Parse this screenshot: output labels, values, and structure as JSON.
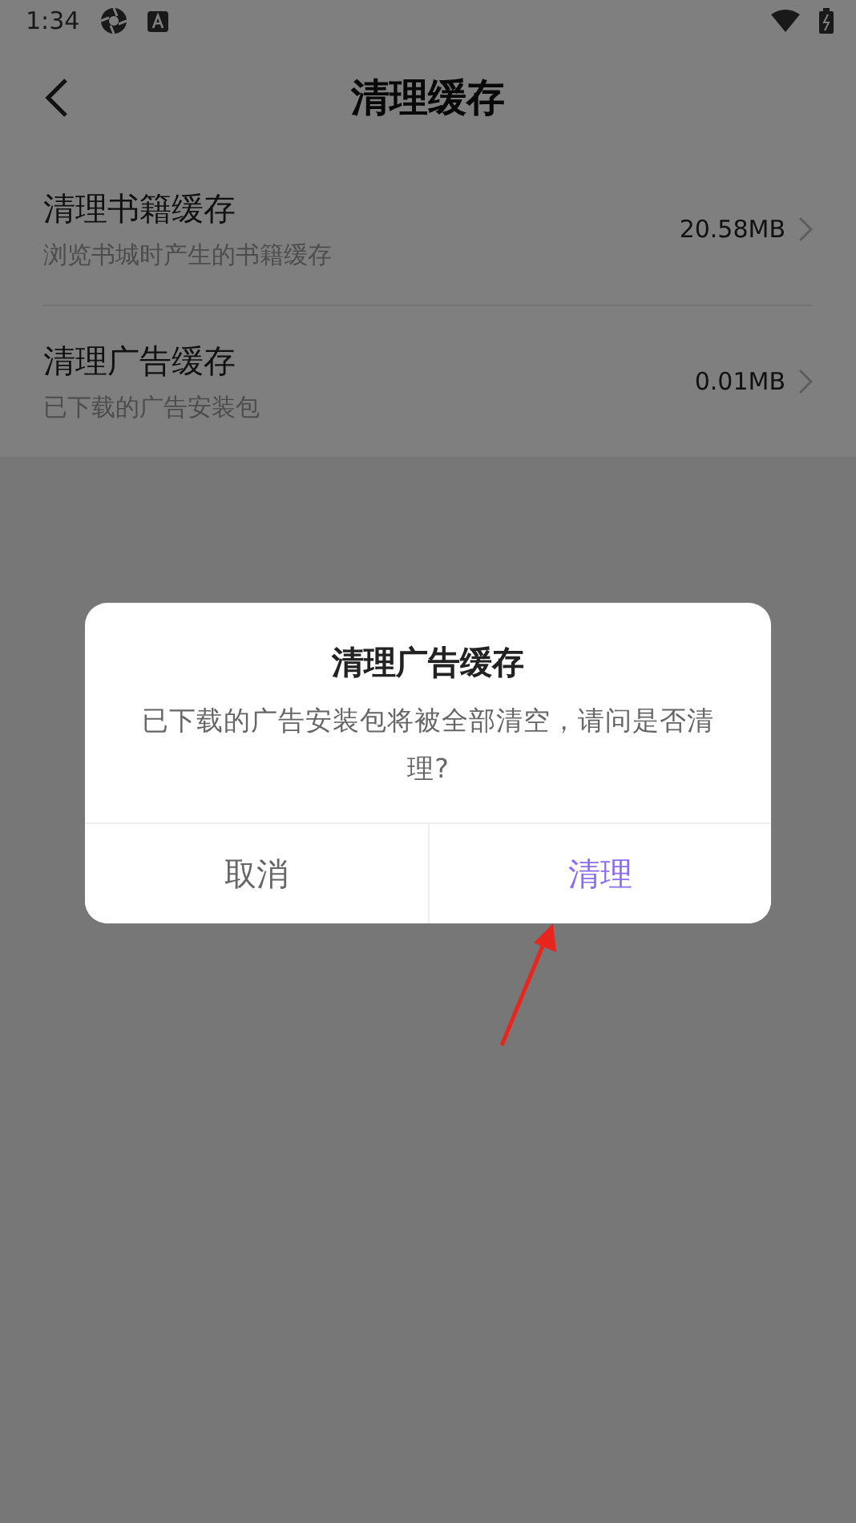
{
  "status_bar": {
    "time": "1:34"
  },
  "header": {
    "title": "清理缓存"
  },
  "items": [
    {
      "title": "清理书籍缓存",
      "subtitle": "浏览书城时产生的书籍缓存",
      "size": "20.58MB"
    },
    {
      "title": "清理广告缓存",
      "subtitle": "已下载的广告安装包",
      "size": "0.01MB"
    }
  ],
  "dialog": {
    "title": "清理广告缓存",
    "message": "已下载的广告安装包将被全部清空，请问是否清理?",
    "buttons": [
      {
        "label": "取消",
        "kind": "cancel"
      },
      {
        "label": "清理",
        "kind": "confirm"
      }
    ]
  }
}
